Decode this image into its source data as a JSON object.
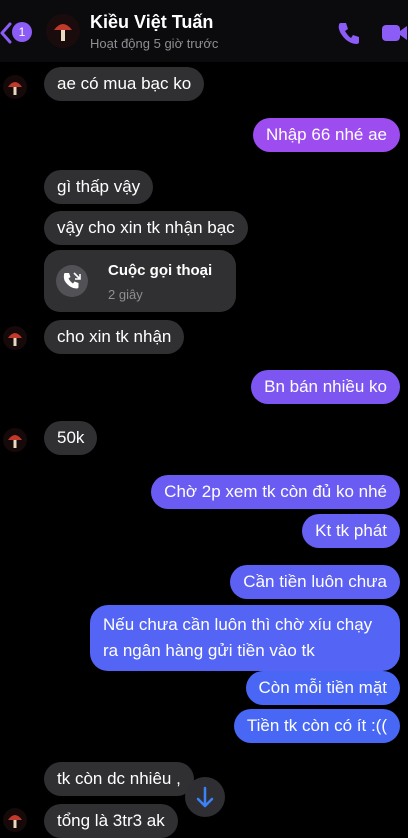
{
  "header": {
    "back_badge": "1",
    "contact_name": "Kiều Việt Tuấn",
    "status": "Hoạt động 5 giờ trước"
  },
  "messages": [
    {
      "side": "in",
      "text": "ae có mua bạc ko"
    },
    {
      "side": "out",
      "text": "Nhập 66 nhé ae"
    },
    {
      "side": "in",
      "text": "gì thấp vậy"
    },
    {
      "side": "in",
      "text": "vậy cho xin tk nhận bạc"
    },
    {
      "side": "in",
      "type": "call",
      "title": "Cuộc gọi thoại",
      "duration": "2 giây"
    },
    {
      "side": "in",
      "text": "cho xin tk nhận"
    },
    {
      "side": "out",
      "text": "Bn bán nhiều ko"
    },
    {
      "side": "in",
      "text": "50k"
    },
    {
      "side": "out",
      "text": "Chờ 2p xem tk còn đủ ko nhé"
    },
    {
      "side": "out",
      "text": "Kt tk phát"
    },
    {
      "side": "out",
      "text": "Cần tiền luôn chưa"
    },
    {
      "side": "out",
      "text": "Nếu chưa cần luôn thì chờ xíu chạy ra ngân hàng gửi tiền vào tk"
    },
    {
      "side": "out",
      "text": "Còn mỗi tiền mặt"
    },
    {
      "side": "out",
      "text": "Tiền tk còn có ít :(("
    },
    {
      "side": "in",
      "text": "tk còn dc nhiêu ,"
    },
    {
      "side": "in",
      "text": "tổng là 3tr3 ak"
    }
  ],
  "colors": {
    "incoming": "#303033",
    "outgoing_top": "#a04bf0",
    "outgoing_bottom": "#3b63f4",
    "accent": "#8b5cf6"
  }
}
